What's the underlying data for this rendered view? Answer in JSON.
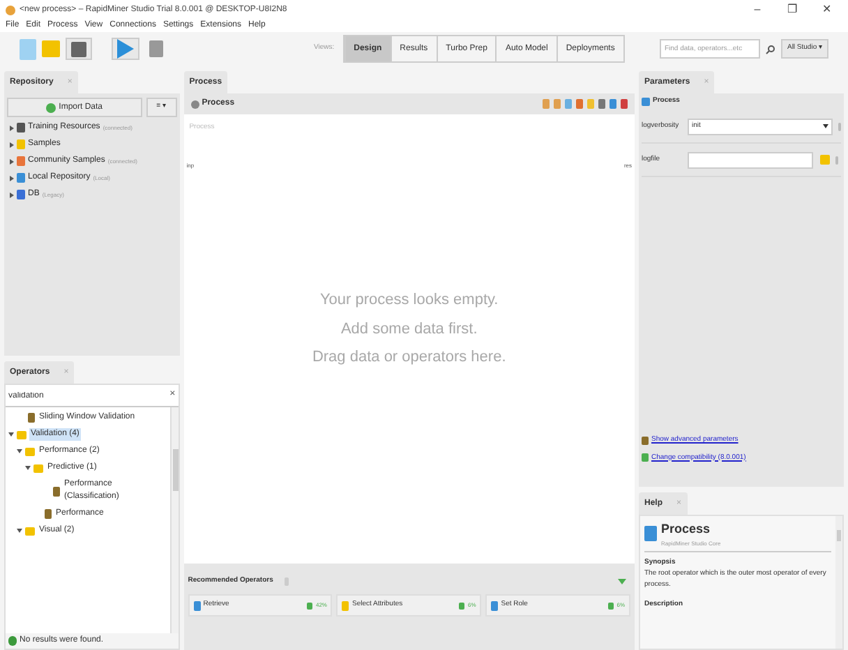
{
  "window": {
    "title": "<new process> – RapidMiner Studio Trial 8.0.001 @ DESKTOP-U8I2N8",
    "controls": [
      "–",
      "❐",
      "✕"
    ]
  },
  "menu": [
    "File",
    "Edit",
    "Process",
    "View",
    "Connections",
    "Settings",
    "Extensions",
    "Help"
  ],
  "toolbar": {
    "views_label": "Views:",
    "views": [
      {
        "label": "Design",
        "selected": true
      },
      {
        "label": "Results",
        "selected": false
      },
      {
        "label": "Turbo Prep",
        "selected": false
      },
      {
        "label": "Auto Model",
        "selected": false
      },
      {
        "label": "Deployments",
        "selected": false
      }
    ],
    "search": {
      "placeholder": "Find data, operators...etc"
    },
    "scope": "All Studio ▾"
  },
  "repository": {
    "tab": "Repository",
    "close": "×",
    "import_button": "Import Data",
    "menu_button": "≡ ▾",
    "items": [
      {
        "label": "Training Resources",
        "note": "(connected)"
      },
      {
        "label": "Samples"
      },
      {
        "label": "Community Samples",
        "note": "(connected)"
      },
      {
        "label": "Local Repository",
        "note": "(Local)"
      },
      {
        "label": "DB",
        "note": "(Legacy)"
      }
    ]
  },
  "operators": {
    "tab": "Operators",
    "close": "×",
    "search": {
      "value": "validation",
      "clear": "×"
    },
    "items": [
      {
        "kind": "operator",
        "label": "Sliding Window Validation",
        "selected": false
      },
      {
        "kind": "folder",
        "label": "Validation (4)",
        "selected": true,
        "expanded": true,
        "children": [
          {
            "kind": "folder",
            "label": "Performance (2)",
            "selected": false,
            "expanded": true,
            "children": [
              {
                "kind": "folder",
                "label": "Predictive (1)",
                "selected": false,
                "expanded": true,
                "children": [
                  {
                    "kind": "operator",
                    "label": "Performance (Classification)",
                    "selected": false
                  }
                ]
              },
              {
                "kind": "operator",
                "label": "Performance",
                "selected": false
              }
            ]
          },
          {
            "kind": "folder",
            "label": "Visual (2)",
            "selected": false,
            "expanded": true
          }
        ]
      }
    ],
    "status": "No results were found."
  },
  "process": {
    "tab": "Process",
    "breadcrumb": "Process",
    "canvas_label": "Process",
    "input_port": "inp",
    "output_port": "res",
    "empty_lines": [
      "Your process looks empty.",
      "Add some data first.",
      "Drag data or operators here."
    ],
    "recommended": {
      "title": "Recommended Operators",
      "items": [
        {
          "label": "Retrieve",
          "share": "42%"
        },
        {
          "label": "Select Attributes",
          "share": "6%"
        },
        {
          "label": "Set Role",
          "share": "6%"
        }
      ]
    }
  },
  "parameters": {
    "tab": "Parameters",
    "close": "×",
    "operator": "Process",
    "rows": [
      {
        "kind": "select",
        "label": "logverbosity",
        "value": "init"
      },
      {
        "kind": "file",
        "label": "logfile",
        "value": ""
      }
    ],
    "links": [
      "Show advanced parameters",
      "Change compatibility (8.0.001)"
    ]
  },
  "help": {
    "tab": "Help",
    "close": "×",
    "title": "Process",
    "subtitle": "RapidMiner Studio Core",
    "synopsis_heading": "Synopsis",
    "synopsis": "The root operator which is the outer most operator of every process.",
    "description_heading": "Description"
  }
}
